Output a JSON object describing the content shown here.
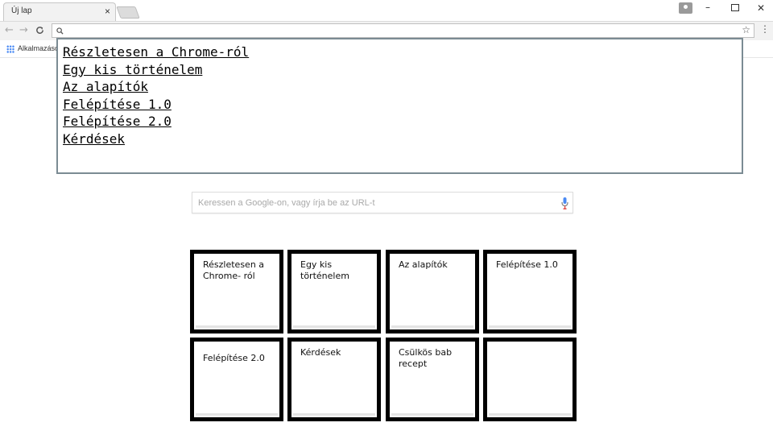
{
  "tab": {
    "title": "Új lap",
    "close": "×"
  },
  "window": {
    "minimize": "–",
    "close": "✕"
  },
  "toolbar": {
    "back": "←",
    "forward": "→",
    "reload": "C",
    "search_icon": "search-icon",
    "star_icon": "star-icon",
    "menu": "⋮"
  },
  "bookmarks": {
    "apps_label": "Alkalmazások"
  },
  "google_search": {
    "placeholder": "Keressen a Google-on, vagy írja be az URL-t"
  },
  "overlay": {
    "links": [
      "Részletesen a Chrome-ról",
      "Egy kis történelem",
      "Az alapítók",
      "Felépítése 1.0",
      "Felépítése 2.0",
      "Kérdések"
    ]
  },
  "tiles": [
    "Részletesen a Chrome- ról",
    "Egy kis történelem",
    "Az alapítók",
    "Felépítése 1.0",
    "Felépítése 2.0",
    "Kérdések",
    "Csülkös bab recept",
    ""
  ],
  "colors": {
    "overlay_border": "#7b8b93",
    "tile_border": "#000000"
  }
}
